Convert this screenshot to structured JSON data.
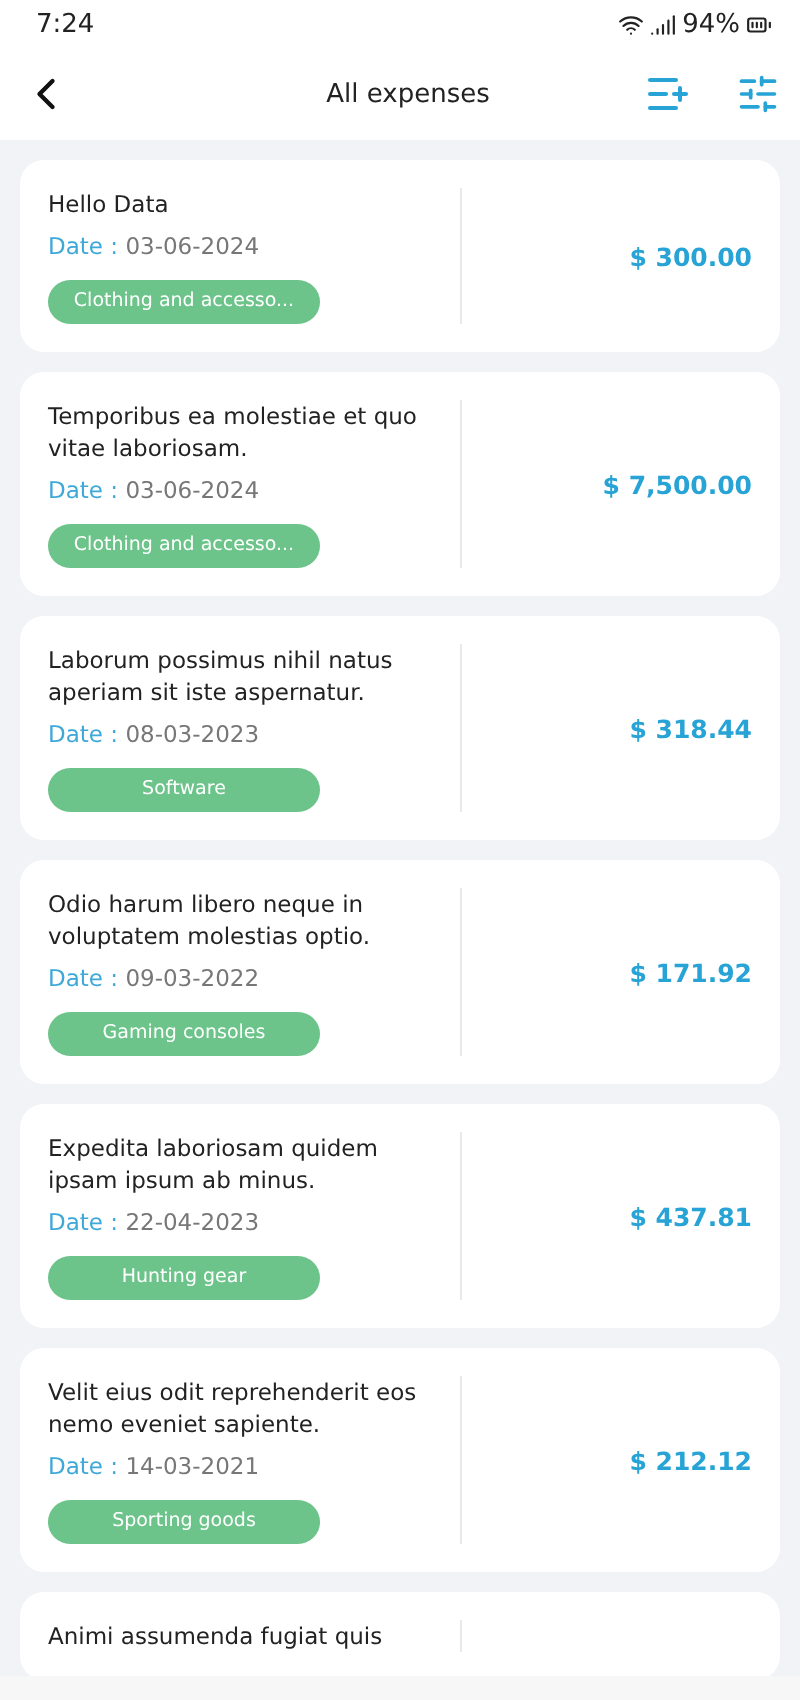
{
  "status_bar": {
    "time": "7:24",
    "battery": "94%"
  },
  "header": {
    "title": "All expenses"
  },
  "expenses": [
    {
      "title": "Hello Data",
      "date_label": "Date :",
      "date": "03-06-2024",
      "category": "Clothing and accesso...",
      "amount": "$ 300.00"
    },
    {
      "title": "Temporibus ea molestiae et quo vitae laboriosam.",
      "date_label": "Date :",
      "date": "03-06-2024",
      "category": "Clothing and accesso...",
      "amount": "$ 7,500.00"
    },
    {
      "title": "Laborum possimus nihil natus aperiam sit iste aspernatur.",
      "date_label": "Date :",
      "date": "08-03-2023",
      "category": "Software",
      "amount": "$ 318.44"
    },
    {
      "title": "Odio harum libero neque in voluptatem molestias optio.",
      "date_label": "Date :",
      "date": "09-03-2022",
      "category": "Gaming consoles",
      "amount": "$ 171.92"
    },
    {
      "title": "Expedita laboriosam quidem ipsam ipsum ab minus.",
      "date_label": "Date :",
      "date": "22-04-2023",
      "category": "Hunting gear",
      "amount": "$ 437.81"
    },
    {
      "title": "Velit eius odit reprehenderit eos nemo eveniet sapiente.",
      "date_label": "Date :",
      "date": "14-03-2021",
      "category": "Sporting goods",
      "amount": "$ 212.12"
    },
    {
      "title": "Animi assumenda fugiat quis"
    }
  ]
}
